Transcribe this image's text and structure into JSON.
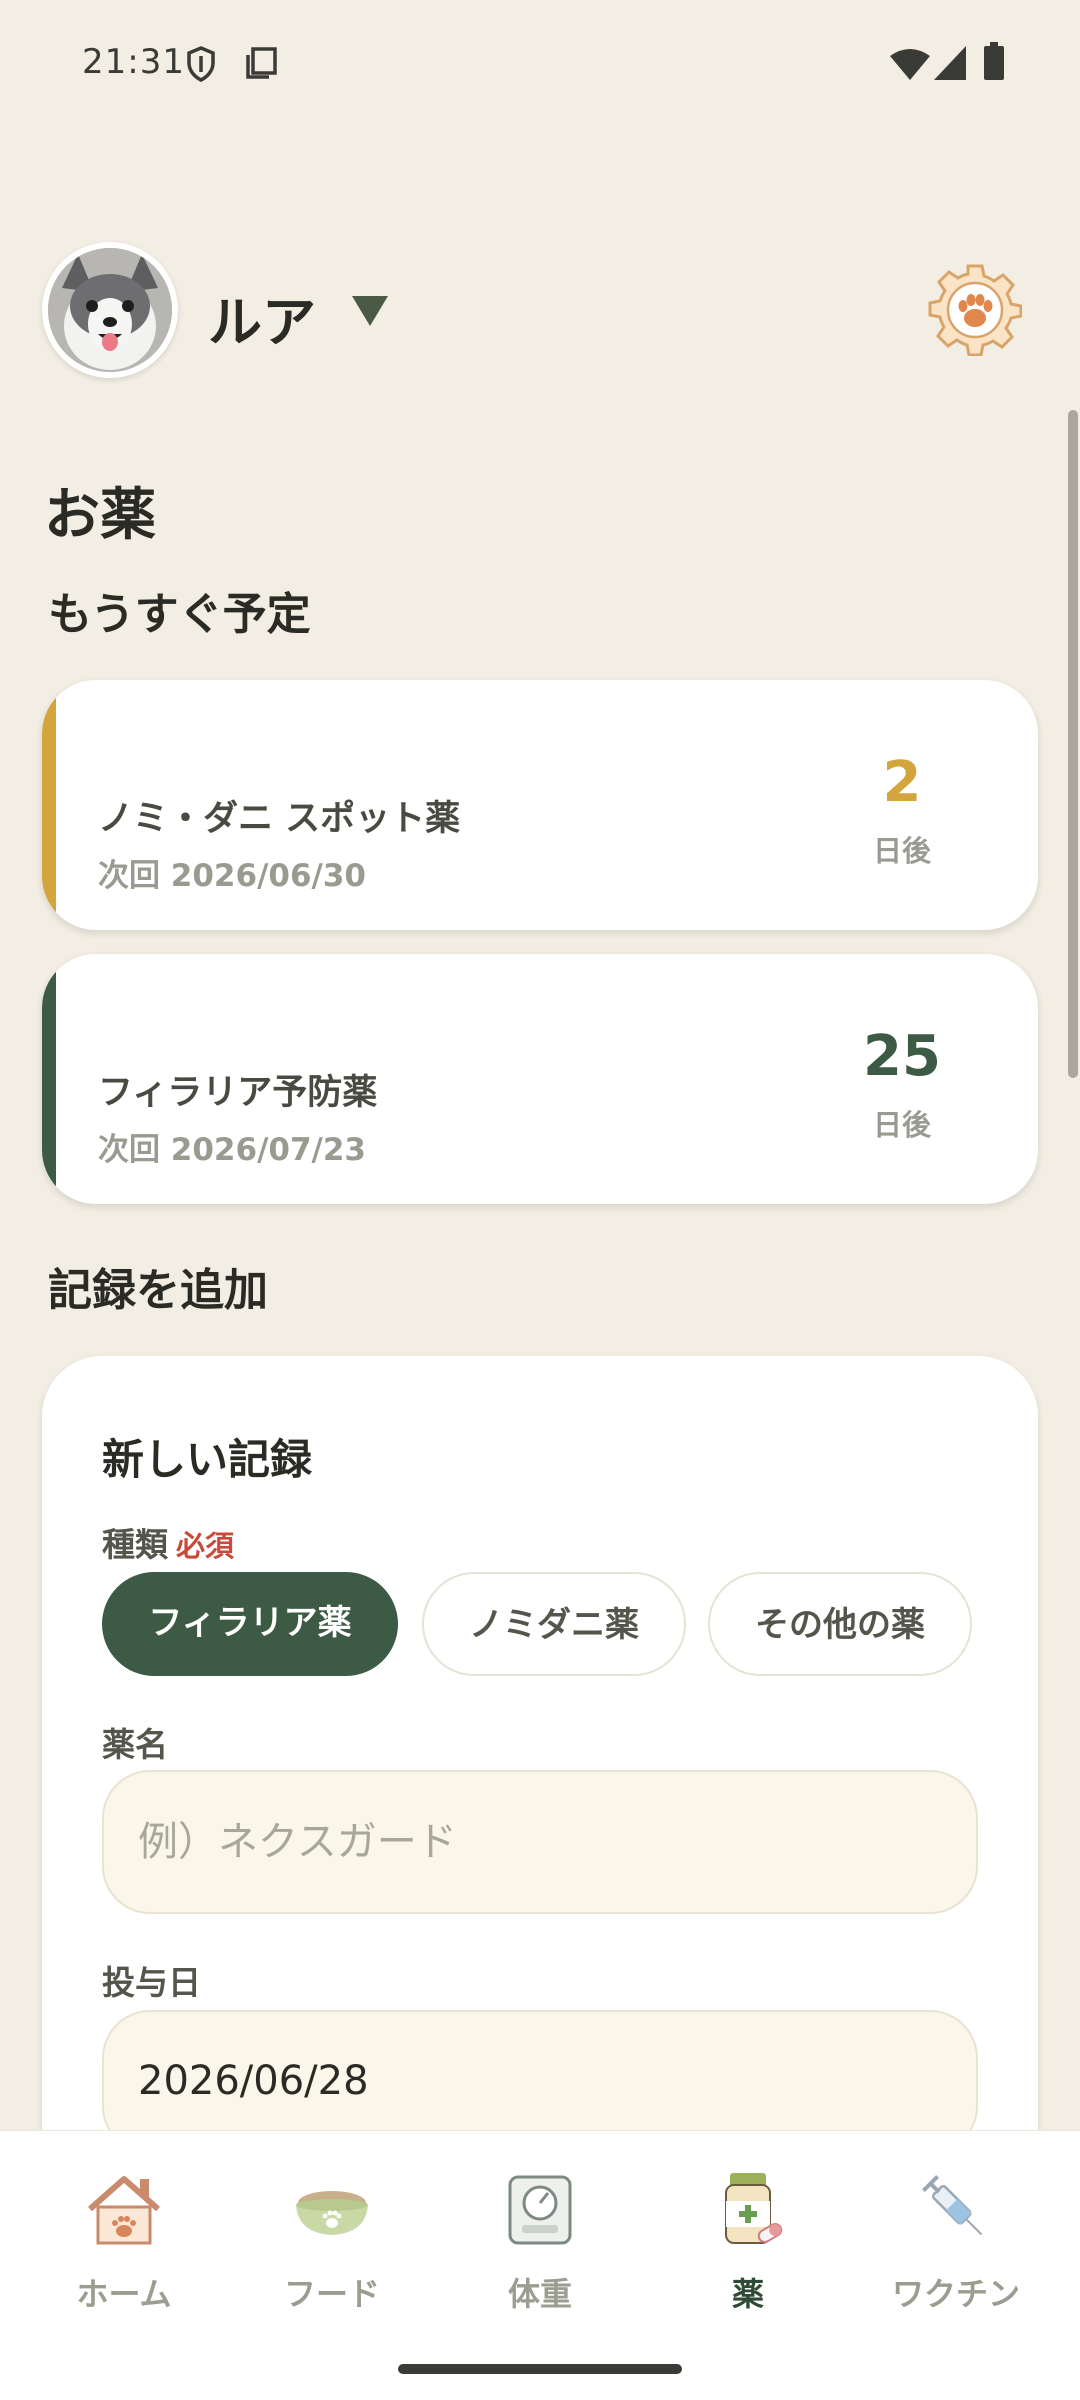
{
  "status_bar": {
    "time": "21:31"
  },
  "header": {
    "pet_name": "ルア"
  },
  "page": {
    "title": "お薬"
  },
  "upcoming": {
    "title": "もうすぐ予定",
    "items": [
      {
        "name": "ノミ・ダニ スポット薬",
        "next": "次回 2026/06/30",
        "days": "2",
        "unit": "日後",
        "accent": "#D4A53C",
        "days_color": "#D4A53C"
      },
      {
        "name": "フィラリア予防薬",
        "next": "次回 2026/07/23",
        "days": "25",
        "unit": "日後",
        "accent": "#3C5A44",
        "days_color": "#3C5A44"
      }
    ]
  },
  "add_record": {
    "section_title": "記録を追加",
    "form_title": "新しい記録",
    "type_label": "種類",
    "required_label": "必須",
    "chips": [
      {
        "label": "フィラリア薬",
        "selected": true
      },
      {
        "label": "ノミダニ薬",
        "selected": false
      },
      {
        "label": "その他の薬",
        "selected": false
      }
    ],
    "name_label": "薬名",
    "name_placeholder": "例）ネクスガード",
    "date_label": "投与日",
    "date_value": "2026/06/28"
  },
  "nav": {
    "items": [
      {
        "label": "ホーム",
        "icon": "home-icon",
        "active": false
      },
      {
        "label": "フード",
        "icon": "food-bowl-icon",
        "active": false
      },
      {
        "label": "体重",
        "icon": "scale-icon",
        "active": false
      },
      {
        "label": "薬",
        "icon": "medicine-icon",
        "active": true
      },
      {
        "label": "ワクチン",
        "icon": "syringe-icon",
        "active": false
      }
    ]
  },
  "colors": {
    "background": "#F2EEE3",
    "primary": "#3C5A44",
    "accent": "#D4A53C",
    "required": "#C74A3A"
  }
}
